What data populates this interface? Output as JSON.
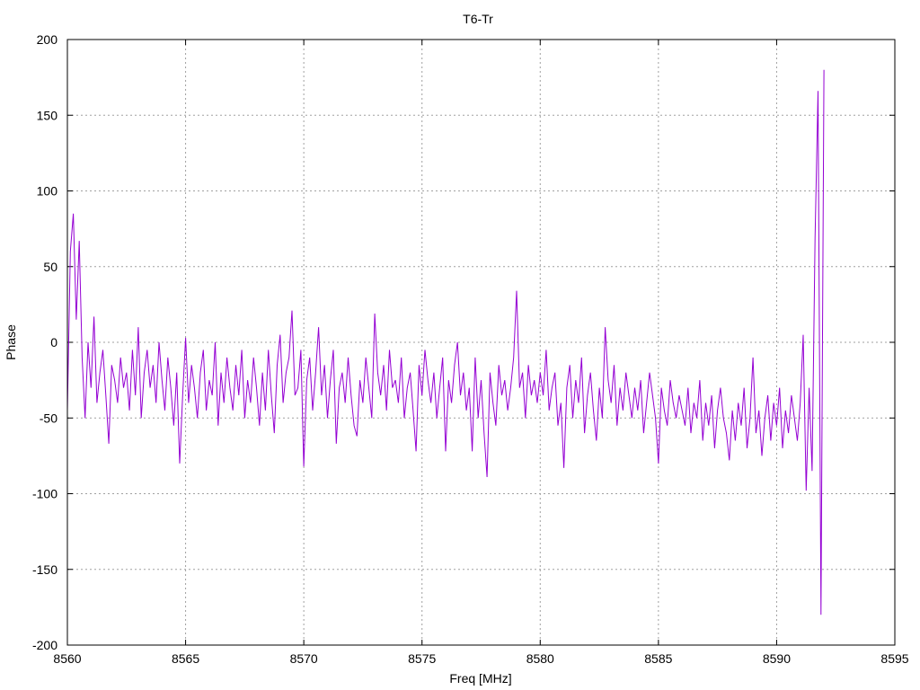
{
  "chart_data": {
    "type": "line",
    "title": "T6-Tr",
    "xlabel": "Freq [MHz]",
    "ylabel": "Phase",
    "xlim": [
      8560,
      8595
    ],
    "ylim": [
      -200,
      200
    ],
    "xticks": [
      8560,
      8565,
      8570,
      8575,
      8580,
      8585,
      8590,
      8595
    ],
    "yticks": [
      -200,
      -150,
      -100,
      -50,
      0,
      50,
      100,
      150,
      200
    ],
    "grid": true,
    "series": [
      {
        "name": "T6-Tr",
        "color": "#9400d3",
        "x_start": 8560,
        "x_step": 0.125,
        "values": [
          -45,
          60,
          85,
          15,
          67,
          -10,
          -50,
          0,
          -30,
          17,
          -40,
          -20,
          -5,
          -35,
          -67,
          -15,
          -25,
          -40,
          -10,
          -30,
          -20,
          -45,
          -5,
          -35,
          10,
          -50,
          -20,
          -5,
          -30,
          -15,
          -40,
          0,
          -25,
          -45,
          -10,
          -30,
          -55,
          -20,
          -80,
          -35,
          3,
          -40,
          -15,
          -30,
          -50,
          -20,
          -5,
          -45,
          -25,
          -35,
          0,
          -55,
          -20,
          -40,
          -10,
          -30,
          -45,
          -15,
          -35,
          -5,
          -50,
          -25,
          -40,
          -10,
          -30,
          -55,
          -20,
          -45,
          -5,
          -35,
          -60,
          -15,
          5,
          -40,
          -20,
          -10,
          21,
          -35,
          -30,
          -5,
          -82,
          -25,
          -10,
          -45,
          -20,
          10,
          -35,
          -15,
          -50,
          -25,
          -5,
          -67,
          -30,
          -20,
          -40,
          -10,
          -35,
          -55,
          -62,
          -25,
          -40,
          -10,
          -30,
          -50,
          19,
          -20,
          -35,
          -15,
          -45,
          -5,
          -30,
          -25,
          -40,
          -10,
          -50,
          -30,
          -20,
          -45,
          -72,
          -15,
          -35,
          -5,
          -25,
          -40,
          -20,
          -50,
          -30,
          -10,
          -72,
          -25,
          -40,
          -15,
          0,
          -35,
          -20,
          -45,
          -30,
          -72,
          -10,
          -50,
          -25,
          -60,
          -89,
          -20,
          -40,
          -55,
          -15,
          -35,
          -25,
          -45,
          -30,
          -10,
          34,
          -30,
          -20,
          -50,
          -15,
          -35,
          -25,
          -40,
          -20,
          -35,
          -5,
          -45,
          -30,
          -20,
          -55,
          -40,
          -83,
          -30,
          -15,
          -50,
          -25,
          -40,
          -10,
          -60,
          -35,
          -20,
          -45,
          -65,
          -30,
          -50,
          10,
          -25,
          -40,
          -15,
          -55,
          -30,
          -45,
          -20,
          -35,
          -50,
          -30,
          -45,
          -25,
          -60,
          -40,
          -20,
          -35,
          -50,
          -80,
          -30,
          -45,
          -55,
          -25,
          -40,
          -50,
          -35,
          -45,
          -55,
          -30,
          -60,
          -40,
          -50,
          -25,
          -65,
          -40,
          -55,
          -35,
          -70,
          -45,
          -30,
          -50,
          -60,
          -78,
          -45,
          -65,
          -40,
          -55,
          -30,
          -70,
          -50,
          -10,
          -60,
          -45,
          -75,
          -50,
          -35,
          -65,
          -40,
          -55,
          -30,
          -70,
          -45,
          -60,
          -35,
          -50,
          -65,
          -40,
          5,
          -98,
          -30,
          -85,
          69,
          166,
          -180,
          180
        ]
      }
    ]
  }
}
